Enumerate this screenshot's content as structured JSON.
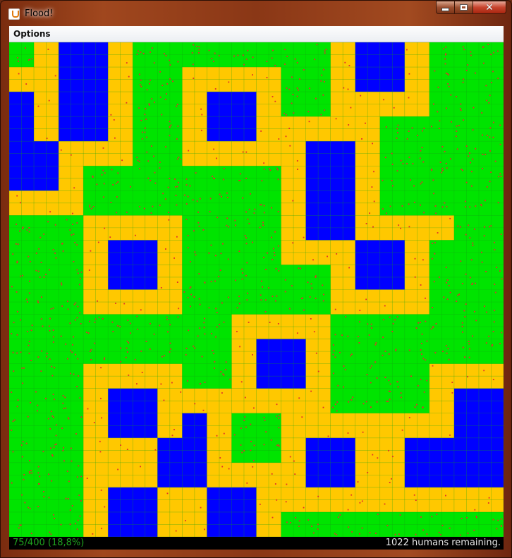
{
  "window": {
    "title": "Flood!",
    "app_icon": "java-cup-icon",
    "controls": {
      "minimize_icon": "minimize-icon",
      "maximize_icon": "maximize-icon",
      "close_icon": "close-icon"
    }
  },
  "menubar": {
    "items": [
      {
        "label": "Options"
      }
    ]
  },
  "status": {
    "progress": "75/400 (18,8%)",
    "humans": "1022 humans remaining."
  },
  "board": {
    "grid_size": 20,
    "colors": {
      "G": "#00e400",
      "Y": "#ffc800",
      "B": "#0000ff",
      "grid": "#12a212",
      "human": "#e0302a"
    },
    "legend": {
      "G": "land",
      "Y": "flooding-front",
      "B": "water"
    },
    "rows": [
      "GYBBYGGGGGGGGYBBYGGG",
      "YYBBYGGYYYYGGYBBYGGG",
      "BYBBYGGYBBYGGYYYYGGG",
      "BYBBYGGYBBYYYYYGGGGG",
      "BBYYYGGYYYYYBBYGGGGG",
      "BBYGGGGGGGGYBBYGGGGG",
      "YYYGGGGGGGGYBBYGGGGG",
      "GGGYYYYGGGGYBBYYYYGG",
      "GGGYBBYGGGGYYYBBYGGG",
      "GGGYBBYGGGGGGYBBYGGG",
      "GGGYYYYGGGGGGYYYYGGG",
      "GGGGGGGGGYYYYGGGGGGG",
      "GGGGGGGGGYBBYGGGGGGG",
      "GGGYYYYGGYBBYGGGGYYY",
      "GGGYBBYYYYYYYGGGGYBB",
      "GGGYBBYBYGGYYYYYYYBB",
      "GGGYYYBBYGGYBBYYBBBB",
      "GGGYYYBBYYYYBBYYBBBB",
      "GGGYBBYYBBYYYYYYYYYY",
      "GGGYBBYYBBYGGGGGGGGG"
    ]
  }
}
